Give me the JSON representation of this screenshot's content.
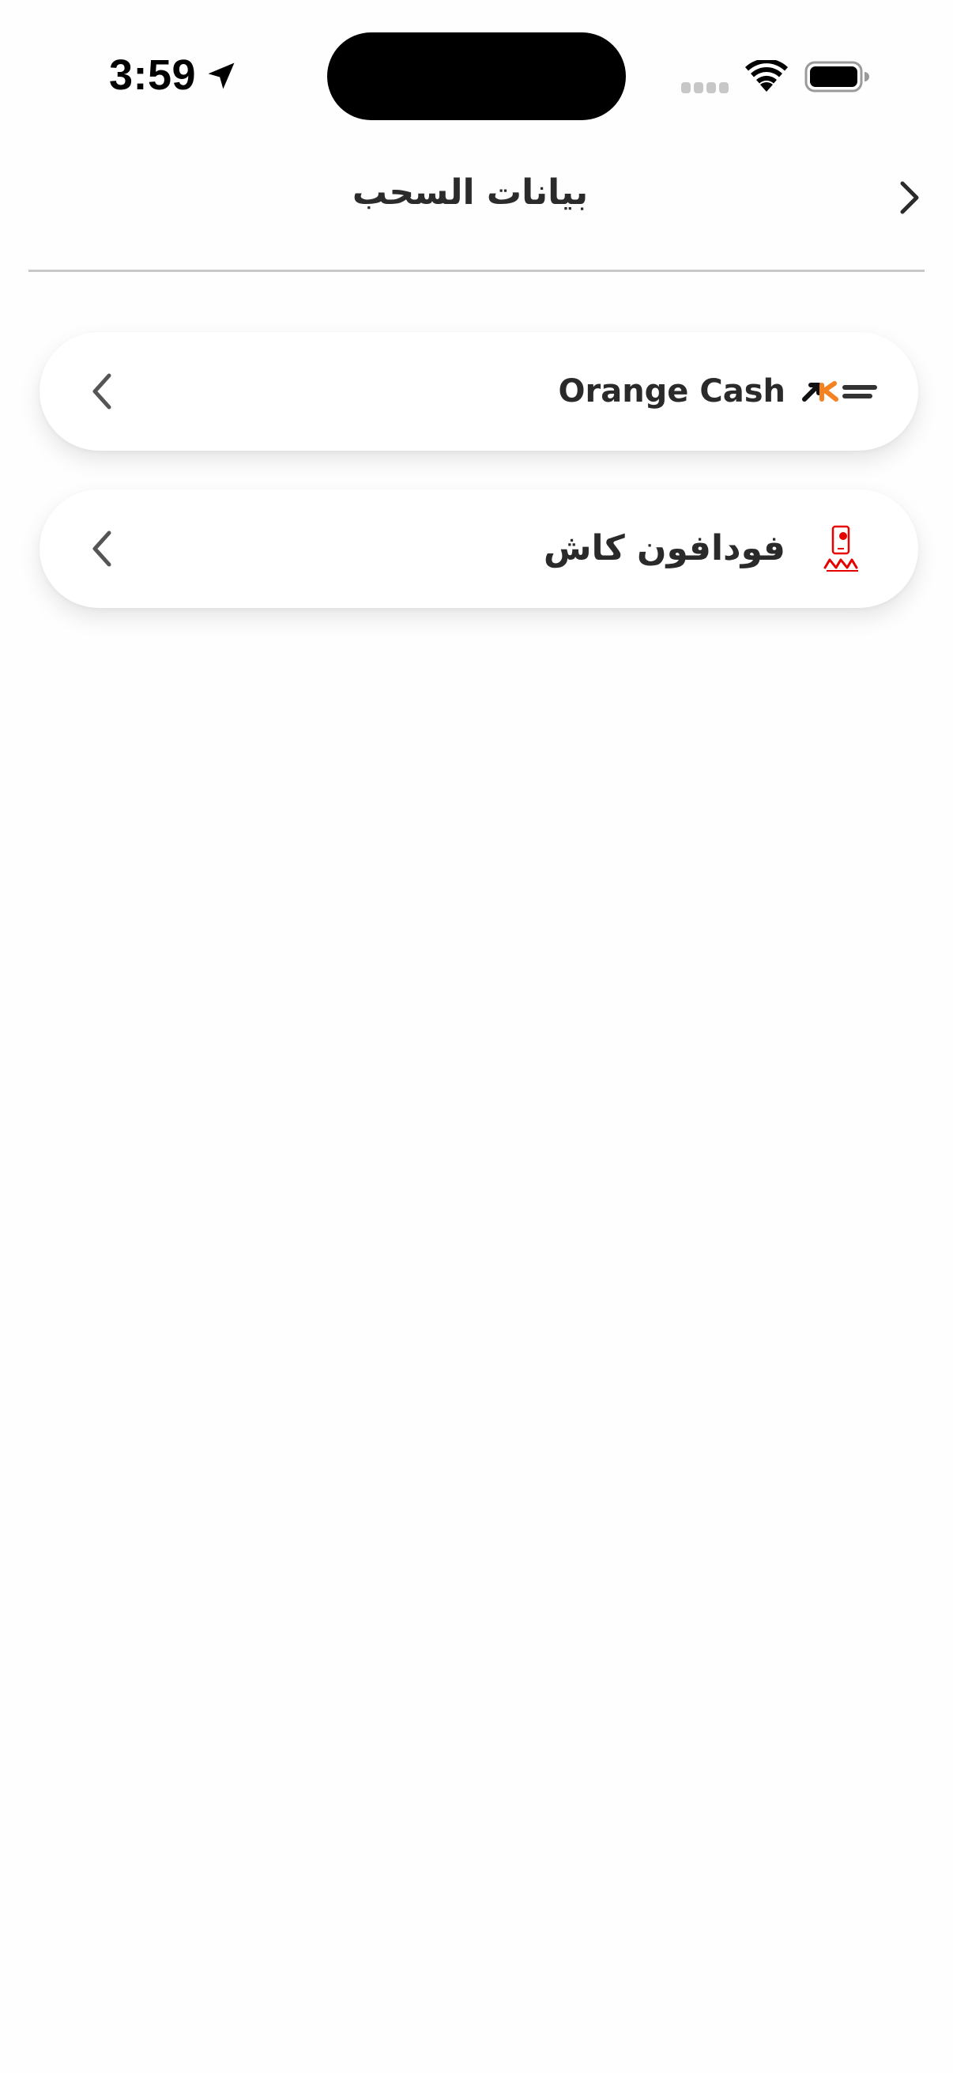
{
  "status_bar": {
    "time": "3:59"
  },
  "header": {
    "title": "بيانات السحب"
  },
  "methods": [
    {
      "label": "Orange Cash",
      "logo_icon": "orange-money-logo"
    },
    {
      "label": "فودافون كاش",
      "logo_icon": "vodafone-cash-logo"
    }
  ],
  "colors": {
    "orange": "#f58220",
    "vodafone_red": "#e60000",
    "text": "#2a2a2a",
    "chevron": "#555555",
    "divider": "#c8c8c8"
  }
}
